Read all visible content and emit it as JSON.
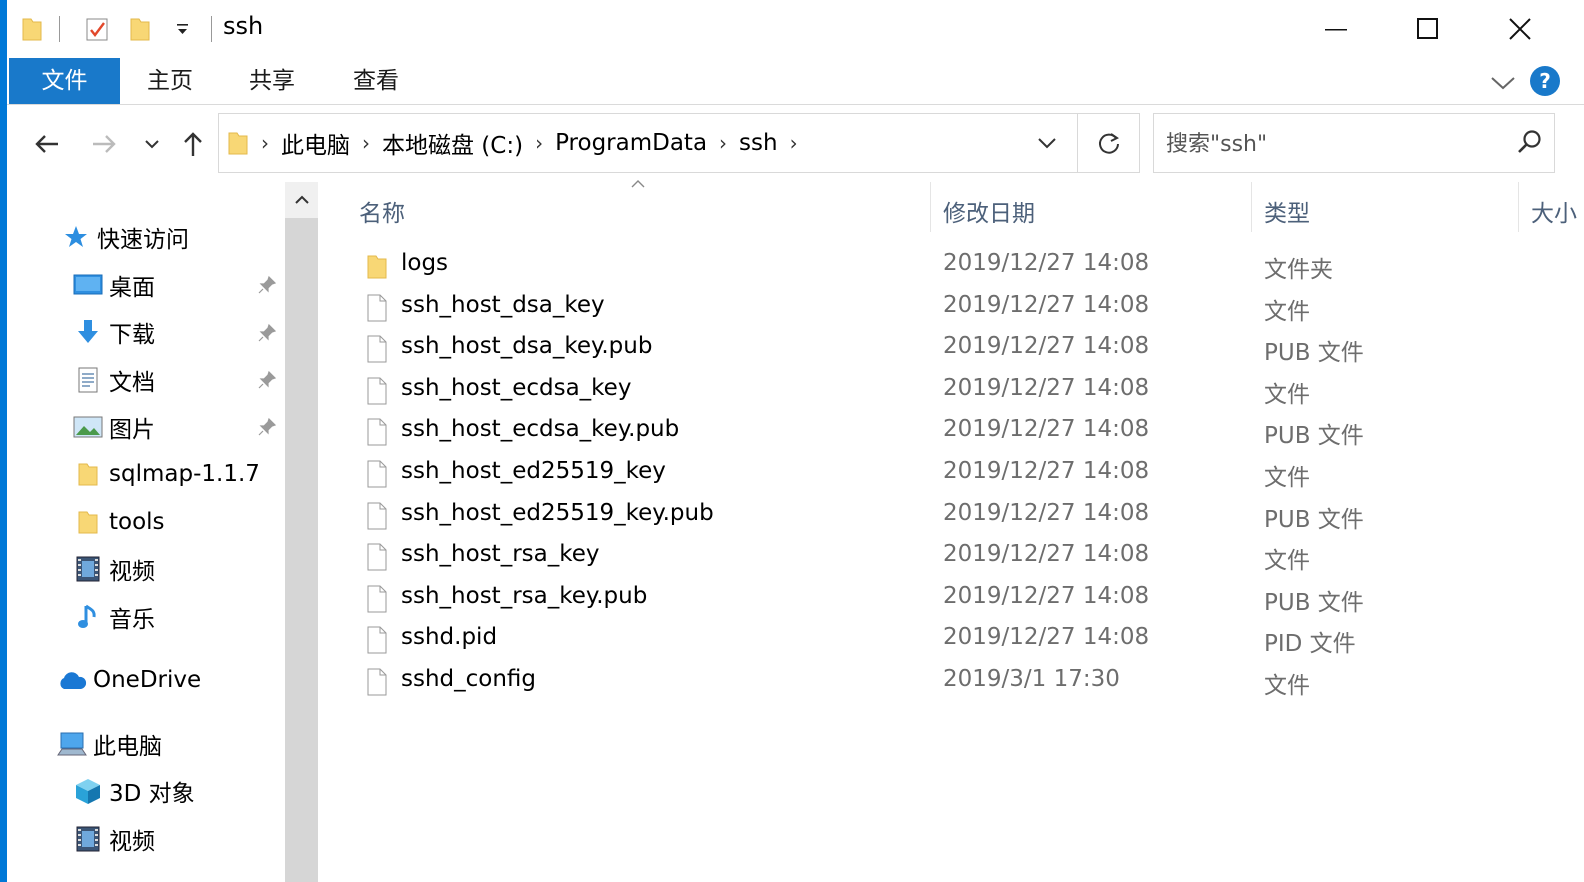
{
  "window": {
    "title": "ssh",
    "controls": [
      "minimize-icon",
      "maximize-icon",
      "close-icon"
    ]
  },
  "ribbon": {
    "tabs": [
      {
        "label": "文件"
      },
      {
        "label": "主页"
      },
      {
        "label": "共享"
      },
      {
        "label": "查看"
      }
    ],
    "help_label": "?"
  },
  "address": {
    "breadcrumbs": [
      "此电脑",
      "本地磁盘 (C:)",
      "ProgramData",
      "ssh"
    ]
  },
  "search": {
    "placeholder": "搜索\"ssh\""
  },
  "nav": {
    "quick_access": "快速访问",
    "pinned": [
      {
        "label": "桌面",
        "icon": "desktop-icon"
      },
      {
        "label": "下载",
        "icon": "download-icon"
      },
      {
        "label": "文档",
        "icon": "document-icon"
      },
      {
        "label": "图片",
        "icon": "pictures-icon"
      }
    ],
    "recent": [
      {
        "label": "sqlmap-1.1.7",
        "icon": "folder-icon"
      },
      {
        "label": "tools",
        "icon": "folder-icon"
      },
      {
        "label": "视频",
        "icon": "video-icon"
      },
      {
        "label": "音乐",
        "icon": "music-icon"
      }
    ],
    "onedrive": "OneDrive",
    "this_pc": "此电脑",
    "pc_items": [
      {
        "label": "3D 对象",
        "icon": "3d-objects-icon"
      },
      {
        "label": "视频",
        "icon": "video-icon"
      }
    ]
  },
  "columns": {
    "name": "名称",
    "date": "修改日期",
    "type": "类型",
    "size": "大小"
  },
  "files": [
    {
      "name": "logs",
      "date": "2019/12/27 14:08",
      "type": "文件夹",
      "icon": "folder-icon"
    },
    {
      "name": "ssh_host_dsa_key",
      "date": "2019/12/27 14:08",
      "type": "文件",
      "icon": "file-icon"
    },
    {
      "name": "ssh_host_dsa_key.pub",
      "date": "2019/12/27 14:08",
      "type": "PUB 文件",
      "icon": "file-icon"
    },
    {
      "name": "ssh_host_ecdsa_key",
      "date": "2019/12/27 14:08",
      "type": "文件",
      "icon": "file-icon"
    },
    {
      "name": "ssh_host_ecdsa_key.pub",
      "date": "2019/12/27 14:08",
      "type": "PUB 文件",
      "icon": "file-icon"
    },
    {
      "name": "ssh_host_ed25519_key",
      "date": "2019/12/27 14:08",
      "type": "文件",
      "icon": "file-icon"
    },
    {
      "name": "ssh_host_ed25519_key.pub",
      "date": "2019/12/27 14:08",
      "type": "PUB 文件",
      "icon": "file-icon"
    },
    {
      "name": "ssh_host_rsa_key",
      "date": "2019/12/27 14:08",
      "type": "文件",
      "icon": "file-icon"
    },
    {
      "name": "ssh_host_rsa_key.pub",
      "date": "2019/12/27 14:08",
      "type": "PUB 文件",
      "icon": "file-icon"
    },
    {
      "name": "sshd.pid",
      "date": "2019/12/27 14:08",
      "type": "PID 文件",
      "icon": "file-icon"
    },
    {
      "name": "sshd_config",
      "date": "2019/3/1 17:30",
      "type": "文件",
      "icon": "file-icon"
    }
  ],
  "colors": {
    "accent": "#0078d7",
    "file_tab": "#1979ca",
    "folder": "#f8d775",
    "header_text": "#4c607a",
    "secondary_text": "#6d6d6d"
  }
}
